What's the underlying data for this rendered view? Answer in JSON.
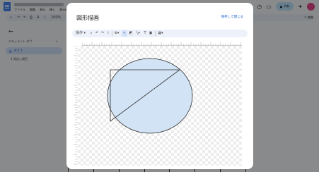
{
  "docs_app": {
    "menu": [
      "ファイル",
      "編集",
      "表示",
      "挿入",
      "表示形式"
    ],
    "zoom": "100%",
    "share_label": "共有",
    "edit_mode_label": "編集",
    "sidebar": {
      "heading": "ドキュメント タブ",
      "tab_label": "タブ 1",
      "outline_item": "1 見出し項目"
    }
  },
  "dialog": {
    "title": "図形描画",
    "save_close_label": "保存して閉じる",
    "toolbar": {
      "actions_label": "操作 ▾",
      "tools": [
        "zoom-icon",
        "undo-icon",
        "redo-icon",
        "format-paint-icon",
        "select-icon",
        "shape-icon",
        "line-icon",
        "textbox-icon",
        "image-icon",
        "fill-icon"
      ]
    },
    "drawing": {
      "shapes": [
        "ellipse",
        "right-triangle"
      ],
      "fill_color": "#d2e3f5",
      "stroke_color": "#2b2b2b"
    }
  }
}
